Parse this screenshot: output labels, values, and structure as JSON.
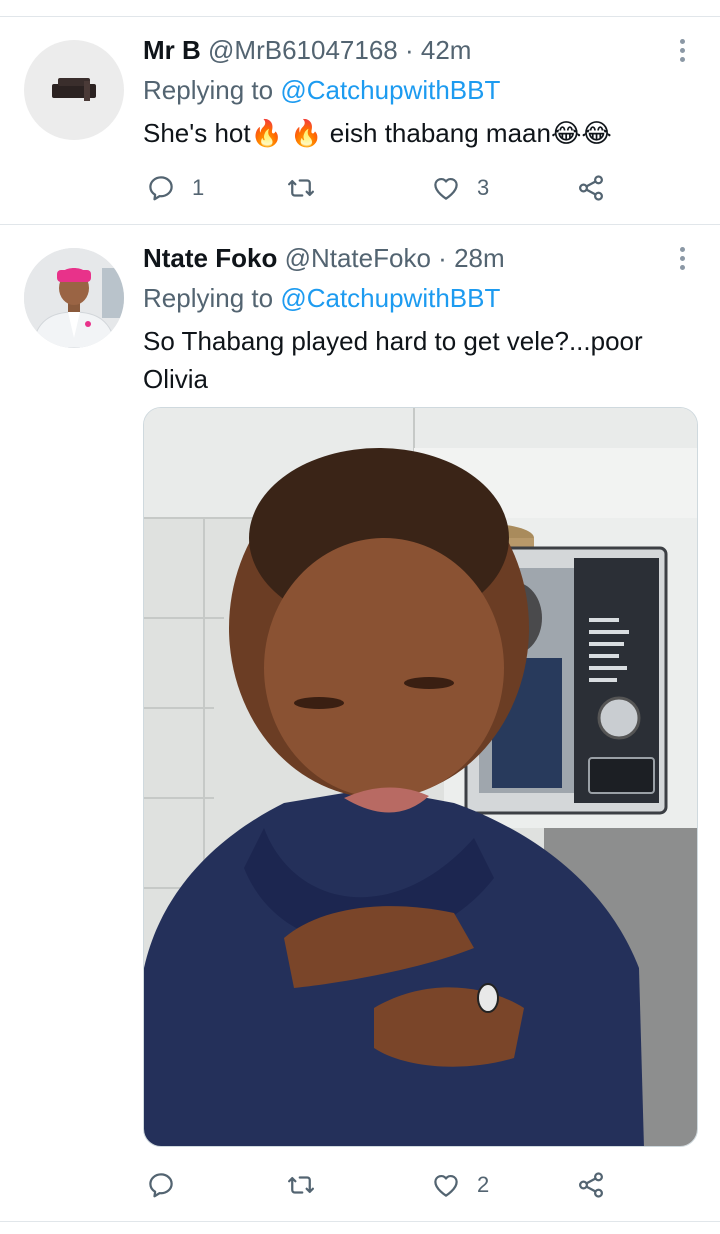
{
  "tweets": [
    {
      "name": "Mr B",
      "handle": "@MrB61047168",
      "separator": "·",
      "time": "42m",
      "replying_prefix": "Replying to",
      "replying_to": "@CatchupwithBBT",
      "text": "She's hot🔥 🔥 eish thabang maan😂😂",
      "replies": "1",
      "retweets": "",
      "likes": "3"
    },
    {
      "name": "Ntate Foko",
      "handle": "@NtateFoko",
      "separator": "·",
      "time": "28m",
      "replying_prefix": "Replying to",
      "replying_to": "@CatchupwithBBT",
      "text": "So Thabang played hard to get vele?...poor Olivia",
      "replies": "",
      "retweets": "",
      "likes": "2"
    }
  ],
  "icons": {
    "reply": "reply-icon",
    "retweet": "retweet-icon",
    "like": "heart-icon",
    "share": "share-icon",
    "more": "more-icon"
  },
  "colors": {
    "text": "#0f1419",
    "secondary": "#536471",
    "mention": "#1d9bf0",
    "divider": "#e1e6ea"
  }
}
